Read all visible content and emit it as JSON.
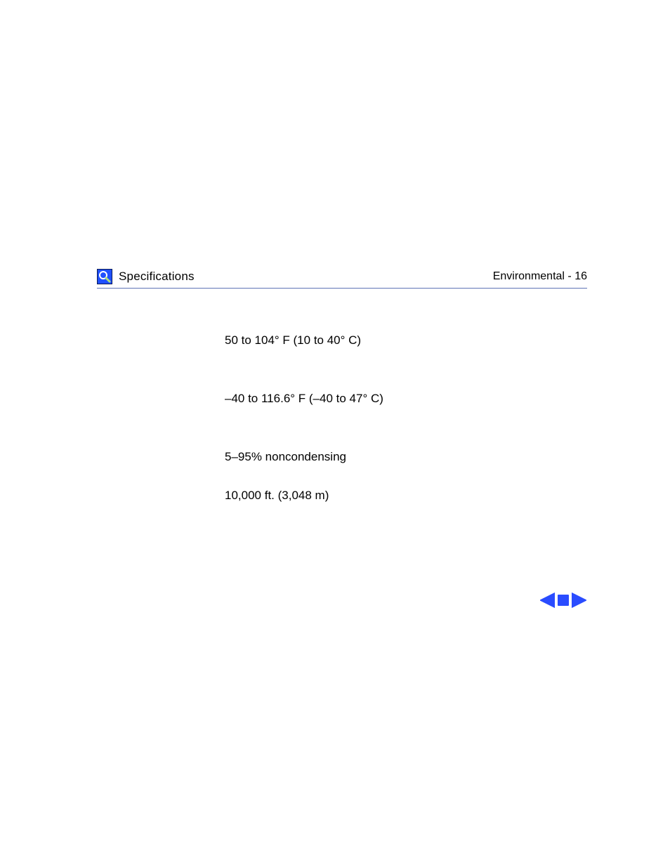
{
  "header": {
    "chapter_title": "Specifications",
    "section_title": "Environmental",
    "page_number": "16"
  },
  "specs": {
    "items": [
      "50 to 104° F (10 to 40° C)",
      "–40 to 116.6° F (–40 to 47° C)",
      "5–95% noncondensing",
      "10,000 ft. (3,048 m)"
    ]
  },
  "icons": {
    "chapter_icon": "tool-loupe-icon",
    "prev": "nav-prev-icon",
    "stop": "nav-stop-icon",
    "next": "nav-next-icon"
  }
}
